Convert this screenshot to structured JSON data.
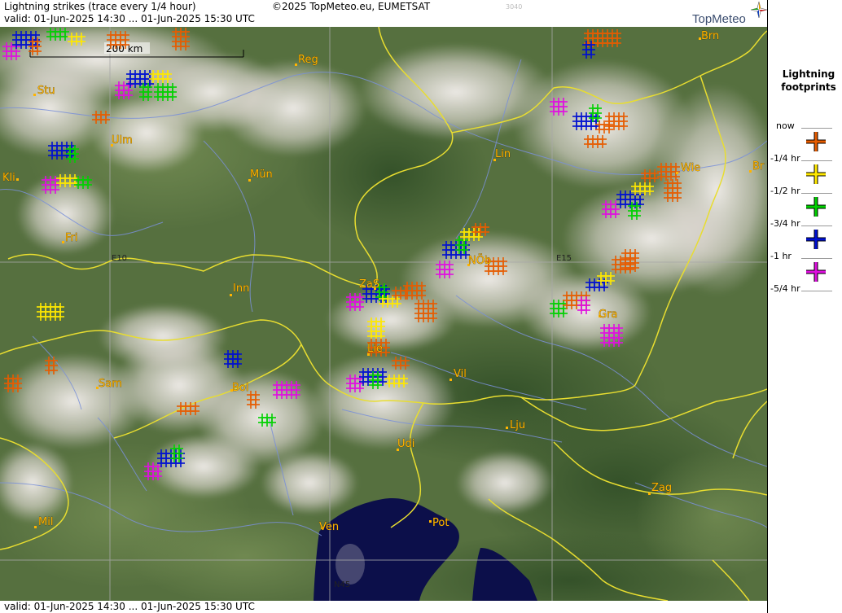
{
  "header": {
    "title": "Lightning strikes (trace every 1/4 hour)",
    "copyright": "©2025 TopMeteo.eu, EUMETSAT",
    "map_code": "3040",
    "valid": "valid:  01-Jun-2025 14:30 ... 01-Jun-2025 15:30 UTC",
    "logo_text": "TopMeteo"
  },
  "footer": {
    "valid": "valid:  01-Jun-2025 14:30 ... 01-Jun-2025 15:30 UTC"
  },
  "legend": {
    "title_line1": "Lightning",
    "title_line2": "footprints",
    "items": [
      {
        "label": "now",
        "color": "#e65c00",
        "code": "now"
      },
      {
        "label": "-1/4 hr",
        "color": "#ffe800",
        "code": "q1"
      },
      {
        "label": "-1/2 hr",
        "color": "#00d000",
        "code": "q2"
      },
      {
        "label": "-3/4 hr",
        "color": "#0010d0",
        "code": "q3"
      },
      {
        "label": "-1 hr",
        "color": "#e010e0",
        "code": "q4"
      },
      {
        "label": "-5/4 hr",
        "color": "#e010e0",
        "code": "q5"
      }
    ]
  },
  "map": {
    "scale_bar": "200 km",
    "coord_labels": [
      "E10",
      "E15",
      "N45"
    ],
    "cities": [
      "Brn",
      "Reg",
      "Stu",
      "Ulm",
      "Lin",
      "Wie",
      "Br",
      "Kli",
      "Mün",
      "Fri",
      "NÖb",
      "Inn",
      "ZaS",
      "Gra",
      "Lie",
      "Vil",
      "Sam",
      "Bol",
      "Lju",
      "Udi",
      "Zag",
      "Ven",
      "Pot",
      "Mil"
    ],
    "clusters": [
      {
        "label": "Brn",
        "seq": [
          "now",
          "now",
          "q3"
        ]
      },
      {
        "label": "Stu",
        "seq": [
          "q5",
          "q3",
          "now",
          "q2",
          "q1",
          "now",
          "now"
        ]
      },
      {
        "label": "Ulm",
        "seq": [
          "q5",
          "q3",
          "q2",
          "q1",
          "now",
          "q2"
        ]
      },
      {
        "label": "Kli",
        "seq": [
          "q5",
          "q3",
          "q2",
          "q1",
          "q2"
        ]
      },
      {
        "label": "Lin",
        "seq": [
          "q5",
          "q3",
          "q2",
          "now",
          "now",
          "now"
        ]
      },
      {
        "label": "Wie",
        "seq": [
          "q5",
          "q3",
          "q2",
          "q1",
          "now",
          "now",
          "now"
        ]
      },
      {
        "label": "NÖb",
        "seq": [
          "q5",
          "q3",
          "q2",
          "q1",
          "now",
          "now"
        ]
      },
      {
        "label": "ZaS",
        "seq": [
          "q5",
          "q3",
          "q2",
          "q1",
          "now",
          "now",
          "q1",
          "now"
        ]
      },
      {
        "label": "Gra",
        "seq": [
          "q2",
          "now",
          "q5",
          "q3",
          "q1",
          "now",
          "now",
          "q5"
        ]
      },
      {
        "label": "Lie",
        "seq": [
          "q5",
          "q3",
          "q2",
          "q1",
          "now",
          "now"
        ]
      },
      {
        "label": "Bol",
        "seq": [
          "q3",
          "q5",
          "now",
          "now",
          "q2"
        ]
      },
      {
        "label": "Sam",
        "seq": [
          "now",
          "q1",
          "now"
        ]
      },
      {
        "label": "Mil",
        "seq": [
          "q5",
          "q3",
          "q2"
        ]
      }
    ]
  }
}
